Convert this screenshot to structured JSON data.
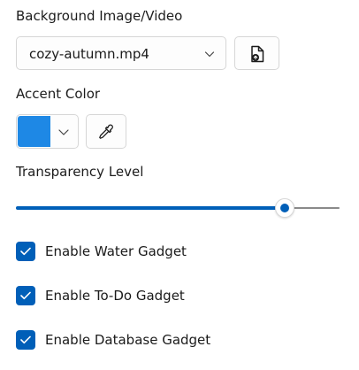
{
  "colors": {
    "accent": "#005fb8",
    "swatch": "#1e88e5",
    "track_rest": "#8a8a8a"
  },
  "background": {
    "label": "Background Image/Video",
    "selected_file": "cozy-autumn.mp4",
    "dropdown_icon": "chevron-down-icon",
    "browse_icon": "file-browse-icon"
  },
  "accent_color": {
    "label": "Accent Color",
    "picker_icon": "eyedropper-icon"
  },
  "transparency": {
    "label": "Transparency Level",
    "value_fraction": 0.83
  },
  "gadgets": [
    {
      "label": "Enable Water Gadget",
      "checked": true
    },
    {
      "label": "Enable To-Do Gadget",
      "checked": true
    },
    {
      "label": "Enable Database Gadget",
      "checked": true
    }
  ]
}
